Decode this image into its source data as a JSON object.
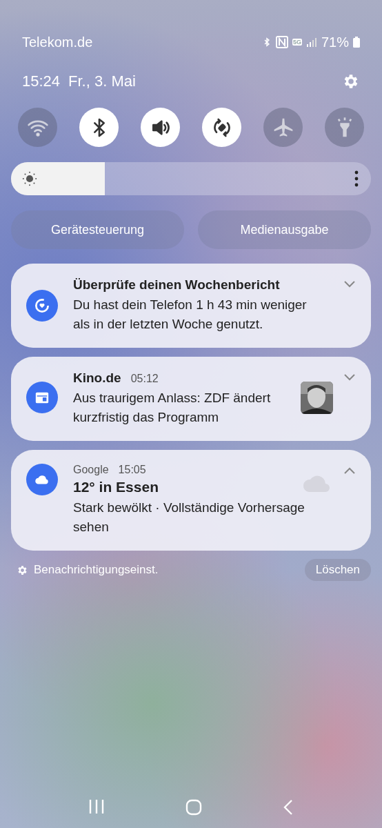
{
  "status_bar": {
    "carrier": "Telekom.de",
    "network": "5G",
    "battery": "71%"
  },
  "header": {
    "time": "15:24",
    "date": "Fr., 3. Mai"
  },
  "toggles": [
    {
      "kind": "wifi",
      "on": false
    },
    {
      "kind": "bluetooth",
      "on": true
    },
    {
      "kind": "sound",
      "on": true
    },
    {
      "kind": "rotate",
      "on": true
    },
    {
      "kind": "airplane",
      "on": false
    },
    {
      "kind": "flashlight",
      "on": false
    }
  ],
  "brightness": {
    "level": 0.26
  },
  "buttons": [
    "Gerätesteuerung",
    "Medienausgabe"
  ],
  "notifications": [
    {
      "kind": "report",
      "title": "Überprüfe deinen Wochenbericht",
      "body": "Du hast dein Telefon 1 h 43 min weniger als in der letzten Woche genutzt.",
      "expanded": false
    },
    {
      "kind": "calendar",
      "app": "Kino.de",
      "time": "05:12",
      "body": "Aus traurigem Anlass: ZDF ändert kurzfristig das Programm",
      "expanded": false
    },
    {
      "kind": "weather",
      "app": "Google",
      "time": "15:05",
      "title": "12° in Essen",
      "body": "Stark bewölkt · Vollständige Vorhersage sehen",
      "expanded": true
    }
  ],
  "footer": {
    "settings": "Benachrichtigungseinst.",
    "clear": "Löschen"
  }
}
